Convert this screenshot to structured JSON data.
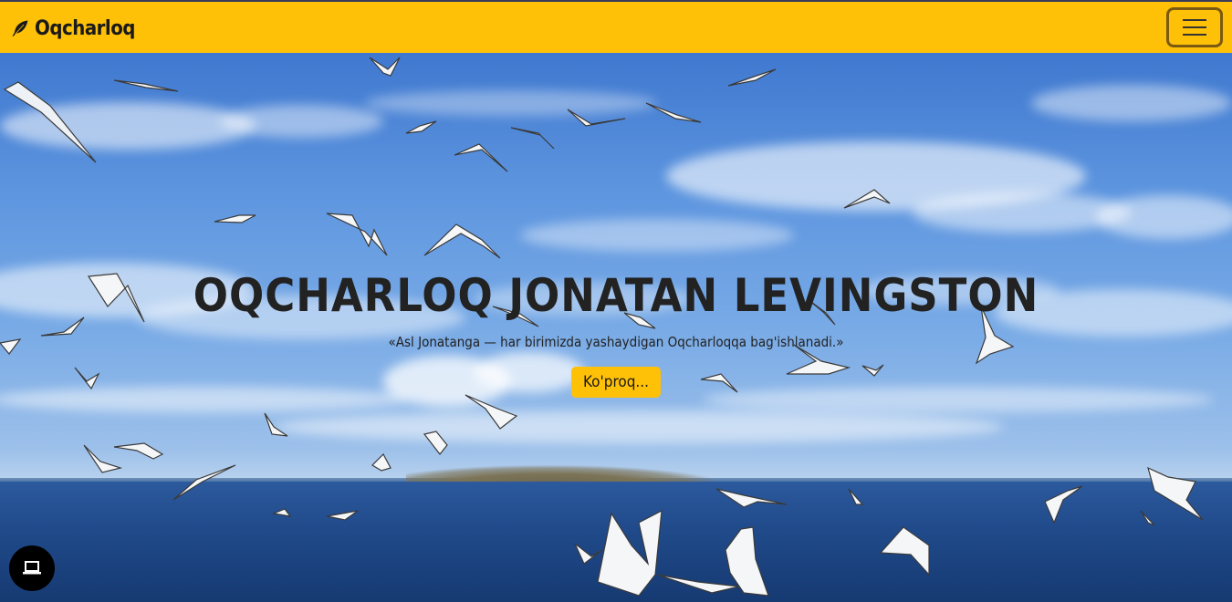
{
  "navbar": {
    "brand_text": "Oqcharloq",
    "brand_icon": "feather-icon",
    "menu_icon": "hamburger-menu-icon",
    "background_color": "#ffc107"
  },
  "hero": {
    "title": "OQCHARLOQ JONATAN LEVINGSTON",
    "subtitle": "«Asl Jonatanga — har birimizda yashaydigan Oqcharloqqa bag'ishlanadi.»",
    "button_label": "Ko'proq...",
    "background_image": "seagulls flying over blue sea under cloudy sky"
  },
  "floating_button": {
    "icon": "laptop-icon"
  }
}
